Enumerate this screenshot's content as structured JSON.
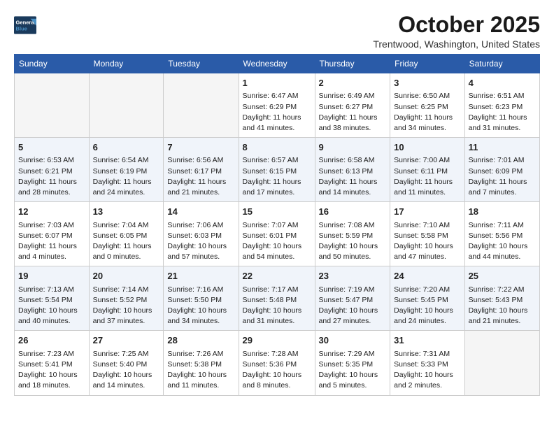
{
  "header": {
    "logo_line1": "General",
    "logo_line2": "Blue",
    "month": "October 2025",
    "location": "Trentwood, Washington, United States"
  },
  "weekdays": [
    "Sunday",
    "Monday",
    "Tuesday",
    "Wednesday",
    "Thursday",
    "Friday",
    "Saturday"
  ],
  "weeks": [
    [
      {
        "day": "",
        "info": ""
      },
      {
        "day": "",
        "info": ""
      },
      {
        "day": "",
        "info": ""
      },
      {
        "day": "1",
        "info": "Sunrise: 6:47 AM\nSunset: 6:29 PM\nDaylight: 11 hours\nand 41 minutes."
      },
      {
        "day": "2",
        "info": "Sunrise: 6:49 AM\nSunset: 6:27 PM\nDaylight: 11 hours\nand 38 minutes."
      },
      {
        "day": "3",
        "info": "Sunrise: 6:50 AM\nSunset: 6:25 PM\nDaylight: 11 hours\nand 34 minutes."
      },
      {
        "day": "4",
        "info": "Sunrise: 6:51 AM\nSunset: 6:23 PM\nDaylight: 11 hours\nand 31 minutes."
      }
    ],
    [
      {
        "day": "5",
        "info": "Sunrise: 6:53 AM\nSunset: 6:21 PM\nDaylight: 11 hours\nand 28 minutes."
      },
      {
        "day": "6",
        "info": "Sunrise: 6:54 AM\nSunset: 6:19 PM\nDaylight: 11 hours\nand 24 minutes."
      },
      {
        "day": "7",
        "info": "Sunrise: 6:56 AM\nSunset: 6:17 PM\nDaylight: 11 hours\nand 21 minutes."
      },
      {
        "day": "8",
        "info": "Sunrise: 6:57 AM\nSunset: 6:15 PM\nDaylight: 11 hours\nand 17 minutes."
      },
      {
        "day": "9",
        "info": "Sunrise: 6:58 AM\nSunset: 6:13 PM\nDaylight: 11 hours\nand 14 minutes."
      },
      {
        "day": "10",
        "info": "Sunrise: 7:00 AM\nSunset: 6:11 PM\nDaylight: 11 hours\nand 11 minutes."
      },
      {
        "day": "11",
        "info": "Sunrise: 7:01 AM\nSunset: 6:09 PM\nDaylight: 11 hours\nand 7 minutes."
      }
    ],
    [
      {
        "day": "12",
        "info": "Sunrise: 7:03 AM\nSunset: 6:07 PM\nDaylight: 11 hours\nand 4 minutes."
      },
      {
        "day": "13",
        "info": "Sunrise: 7:04 AM\nSunset: 6:05 PM\nDaylight: 11 hours\nand 0 minutes."
      },
      {
        "day": "14",
        "info": "Sunrise: 7:06 AM\nSunset: 6:03 PM\nDaylight: 10 hours\nand 57 minutes."
      },
      {
        "day": "15",
        "info": "Sunrise: 7:07 AM\nSunset: 6:01 PM\nDaylight: 10 hours\nand 54 minutes."
      },
      {
        "day": "16",
        "info": "Sunrise: 7:08 AM\nSunset: 5:59 PM\nDaylight: 10 hours\nand 50 minutes."
      },
      {
        "day": "17",
        "info": "Sunrise: 7:10 AM\nSunset: 5:58 PM\nDaylight: 10 hours\nand 47 minutes."
      },
      {
        "day": "18",
        "info": "Sunrise: 7:11 AM\nSunset: 5:56 PM\nDaylight: 10 hours\nand 44 minutes."
      }
    ],
    [
      {
        "day": "19",
        "info": "Sunrise: 7:13 AM\nSunset: 5:54 PM\nDaylight: 10 hours\nand 40 minutes."
      },
      {
        "day": "20",
        "info": "Sunrise: 7:14 AM\nSunset: 5:52 PM\nDaylight: 10 hours\nand 37 minutes."
      },
      {
        "day": "21",
        "info": "Sunrise: 7:16 AM\nSunset: 5:50 PM\nDaylight: 10 hours\nand 34 minutes."
      },
      {
        "day": "22",
        "info": "Sunrise: 7:17 AM\nSunset: 5:48 PM\nDaylight: 10 hours\nand 31 minutes."
      },
      {
        "day": "23",
        "info": "Sunrise: 7:19 AM\nSunset: 5:47 PM\nDaylight: 10 hours\nand 27 minutes."
      },
      {
        "day": "24",
        "info": "Sunrise: 7:20 AM\nSunset: 5:45 PM\nDaylight: 10 hours\nand 24 minutes."
      },
      {
        "day": "25",
        "info": "Sunrise: 7:22 AM\nSunset: 5:43 PM\nDaylight: 10 hours\nand 21 minutes."
      }
    ],
    [
      {
        "day": "26",
        "info": "Sunrise: 7:23 AM\nSunset: 5:41 PM\nDaylight: 10 hours\nand 18 minutes."
      },
      {
        "day": "27",
        "info": "Sunrise: 7:25 AM\nSunset: 5:40 PM\nDaylight: 10 hours\nand 14 minutes."
      },
      {
        "day": "28",
        "info": "Sunrise: 7:26 AM\nSunset: 5:38 PM\nDaylight: 10 hours\nand 11 minutes."
      },
      {
        "day": "29",
        "info": "Sunrise: 7:28 AM\nSunset: 5:36 PM\nDaylight: 10 hours\nand 8 minutes."
      },
      {
        "day": "30",
        "info": "Sunrise: 7:29 AM\nSunset: 5:35 PM\nDaylight: 10 hours\nand 5 minutes."
      },
      {
        "day": "31",
        "info": "Sunrise: 7:31 AM\nSunset: 5:33 PM\nDaylight: 10 hours\nand 2 minutes."
      },
      {
        "day": "",
        "info": ""
      }
    ]
  ]
}
